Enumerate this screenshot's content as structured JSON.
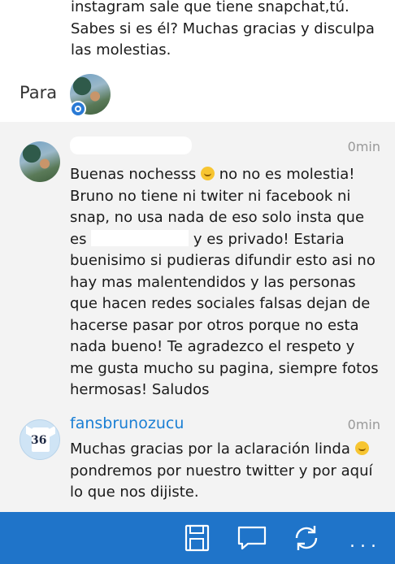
{
  "previous_message": {
    "lines": [
      "instagram sale que tiene snapchat,tú.",
      "Sabes si es él? Muchas gracias y disculpa",
      "las molestias."
    ]
  },
  "recipient": {
    "label": "Para"
  },
  "messages": [
    {
      "time": "0min",
      "body_part1": "Buenas nochesss ",
      "body_part2": " no no es molestia! Bruno no tiene ni twiter ni facebook ni snap, no usa nada de eso solo insta que es ",
      "body_part3": " y es privado! Estaria buenisimo si pudieras difundir esto asi no hay mas malentendidos y las personas que hacen redes sociales falsas dejan de hacerse pasar por otros porque no esta nada bueno! Te agradezco el respeto y me gusta mucho su pagina, siempre fotos hermosas! Saludos"
    },
    {
      "sender": "fansbrunozucu",
      "time": "0min",
      "avatar_text": "36",
      "body_part1": "Muchas gracias por la aclaración linda ",
      "body_part2": " pondremos por nuestro twitter y por aquí lo que nos dijiste."
    }
  ],
  "appbar": {
    "icons": [
      "save-icon",
      "reply-icon",
      "sync-icon",
      "more-icon"
    ],
    "more_label": "..."
  },
  "colors": {
    "accent": "#1f74c9",
    "link": "#1a7fd4",
    "thread_bg": "#f3f3f3"
  }
}
